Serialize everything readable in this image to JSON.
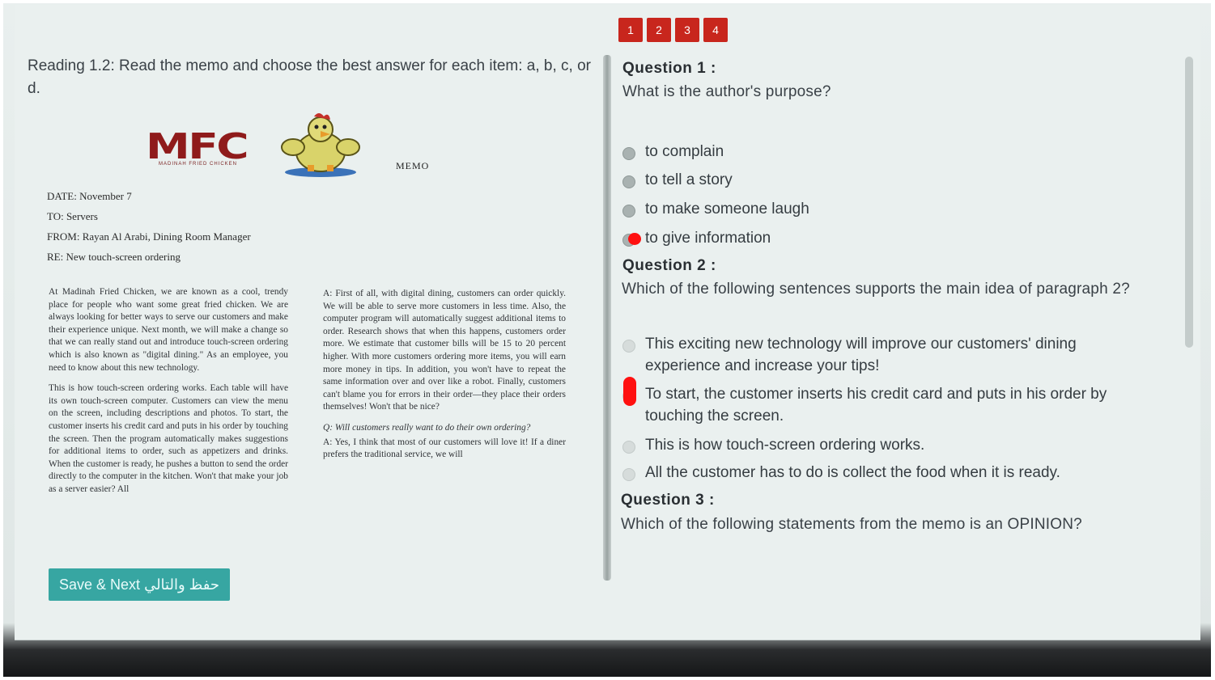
{
  "pager": {
    "pages": [
      "1",
      "2",
      "3",
      "4"
    ]
  },
  "instruction": "Reading 1.2: Read the memo and choose the best answer for each item: a, b, c, or d.",
  "memo": {
    "logo_text": "MFC",
    "logo_subtext": "MADINAH FRIED CHICKEN",
    "label": "MEMO",
    "date": "DATE: November 7",
    "to": "TO: Servers",
    "from": "FROM: Rayan Al Arabi, Dining Room Manager",
    "re": "RE: New touch-screen ordering",
    "col1_p1": "At Madinah Fried Chicken, we are known as a cool, trendy place for people who want some great fried chicken. We are always looking for better ways to serve our customers and make their experience unique. Next month, we will make a change so that we can really stand out and introduce touch-screen ordering which is also known as \"digital dining.\" As an employee, you need to know about this new technology.",
    "col1_p2": "This is how touch-screen ordering works. Each table will have its own touch-screen computer. Customers can view the menu on the screen, including descriptions and photos. To start, the customer inserts his credit card and puts in his order by touching the screen. Then the program automatically makes suggestions for additional items to order, such as appetizers and drinks. When the customer is ready, he pushes a button to send the order directly to the computer in the kitchen. Won't that make your job as a server easier? All",
    "col2_p1": "A: First of all, with digital dining, customers can order quickly. We will be able to serve more customers in less time. Also, the computer program will automatically suggest additional items to order. Research shows that when this happens, customers order more. We estimate that customer bills will be 15 to 20 percent higher. With more customers ordering more items, you will earn more money in tips. In addition, you won't have to repeat the same information over and over like a robot. Finally, customers can't blame you for errors in their order—they place their orders themselves! Won't that be nice?",
    "col2_q": "Q: Will customers really want to do their own ordering?",
    "col2_a": "A: Yes, I think that most of our customers will love it! If a diner prefers the traditional service, we will"
  },
  "save_button": {
    "label": "Save & Next حفظ والتالي"
  },
  "questions": [
    {
      "title": "Question 1 :",
      "text": "What is the author's purpose?",
      "options": [
        "to complain",
        "to tell a story",
        "to make someone laugh",
        "to give information"
      ]
    },
    {
      "title": "Question 2 :",
      "text": "Which of the following sentences supports the main idea of paragraph 2?",
      "options": [
        "This exciting new technology will improve our customers' dining experience and increase your tips!",
        "To start, the customer inserts his credit card and puts in his order by touching the screen.",
        "This is how touch-screen ordering works.",
        "All the customer has to do is collect the food when it is ready."
      ]
    },
    {
      "title": "Question 3 :",
      "text": "Which of the following statements from the memo is an OPINION?"
    }
  ],
  "colors": {
    "accent": "#37a6a2",
    "pager": "#c8261d",
    "mark": "#ff1010"
  }
}
